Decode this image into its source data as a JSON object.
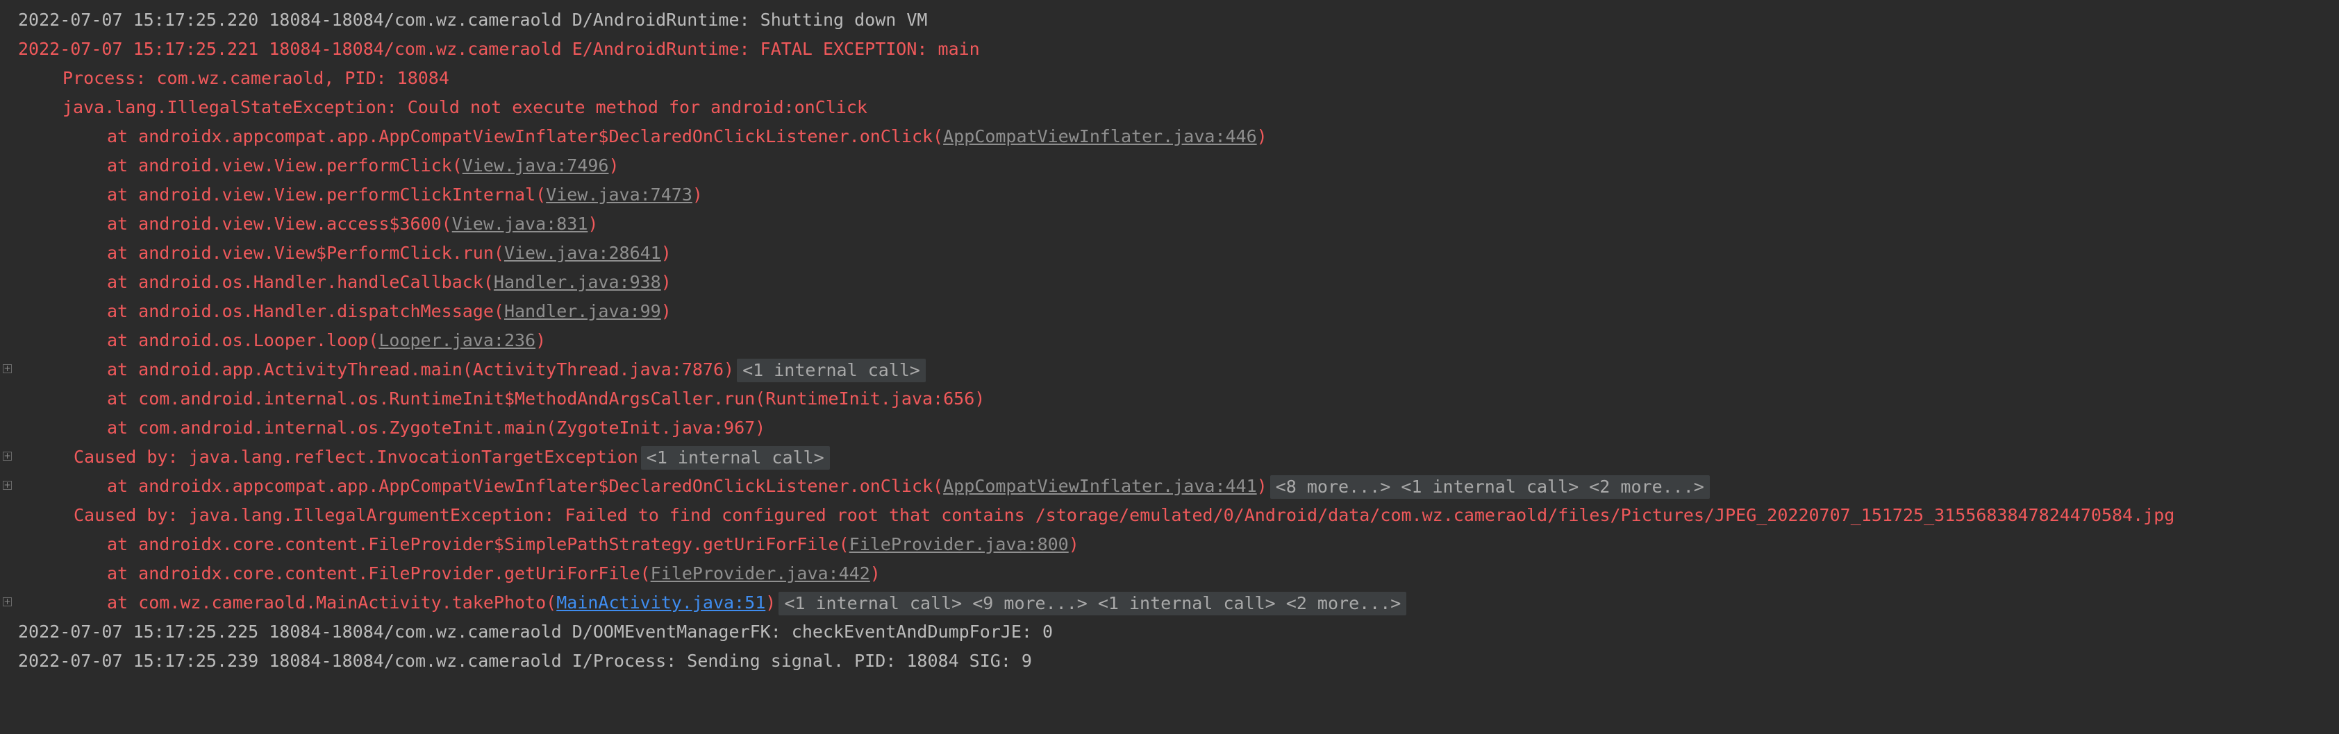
{
  "colors": {
    "background": "#2b2b2b",
    "info_text": "#bbbbbb",
    "error_text": "#f0595b",
    "link_gray": "#8f8f8f",
    "link_blue": "#3f8df0",
    "badge_bg": "#3c3f41"
  },
  "fold_icon": "plus-square-icon",
  "fold_symbol": "+",
  "lines": [
    {
      "t": "2022-07-07 15:17:25.220 18084-18084/com.wz.cameraold D/AndroidRuntime: Shutting down VM"
    },
    {
      "t": "2022-07-07 15:17:25.221 18084-18084/com.wz.cameraold E/AndroidRuntime: FATAL EXCEPTION: main"
    },
    {
      "t": "Process: com.wz.cameraold, PID: 18084"
    },
    {
      "t": "java.lang.IllegalStateException: Could not execute method for android:onClick"
    },
    {
      "pre": "at androidx.appcompat.app.AppCompatViewInflater$DeclaredOnClickListener.onClick(",
      "link": "AppCompatViewInflater.java:446",
      "post": ")"
    },
    {
      "pre": "at android.view.View.performClick(",
      "link": "View.java:7496",
      "post": ")"
    },
    {
      "pre": "at android.view.View.performClickInternal(",
      "link": "View.java:7473",
      "post": ")"
    },
    {
      "pre": "at android.view.View.access$3600(",
      "link": "View.java:831",
      "post": ")"
    },
    {
      "pre": "at android.view.View$PerformClick.run(",
      "link": "View.java:28641",
      "post": ")"
    },
    {
      "pre": "at android.os.Handler.handleCallback(",
      "link": "Handler.java:938",
      "post": ")"
    },
    {
      "pre": "at android.os.Handler.dispatchMessage(",
      "link": "Handler.java:99",
      "post": ")"
    },
    {
      "pre": "at android.os.Looper.loop(",
      "link": "Looper.java:236",
      "post": ")"
    },
    {
      "t": "at android.app.ActivityThread.main(ActivityThread.java:7876)",
      "badge": "<1 internal call>"
    },
    {
      "t": "at com.android.internal.os.RuntimeInit$MethodAndArgsCaller.run(RuntimeInit.java:656)"
    },
    {
      "t": "at com.android.internal.os.ZygoteInit.main(ZygoteInit.java:967)"
    },
    {
      "t": "Caused by: java.lang.reflect.InvocationTargetException",
      "badge": "<1 internal call>"
    },
    {
      "pre": "at androidx.appcompat.app.AppCompatViewInflater$DeclaredOnClickListener.onClick(",
      "link": "AppCompatViewInflater.java:441",
      "post": ")",
      "badge": "<8 more...> <1 internal call> <2 more...>"
    },
    {
      "t": "Caused by: java.lang.IllegalArgumentException: Failed to find configured root that contains /storage/emulated/0/Android/data/com.wz.cameraold/files/Pictures/JPEG_20220707_151725_3155683847824470584.jpg"
    },
    {
      "pre": "at androidx.core.content.FileProvider$SimplePathStrategy.getUriForFile(",
      "link": "FileProvider.java:800",
      "post": ")"
    },
    {
      "pre": "at androidx.core.content.FileProvider.getUriForFile(",
      "link": "FileProvider.java:442",
      "post": ")"
    },
    {
      "pre": "at com.wz.cameraold.MainActivity.takePhoto(",
      "link": "MainActivity.java:51",
      "post": ")",
      "badge": "<1 internal call> <9 more...> <1 internal call> <2 more...>"
    },
    {
      "t": "2022-07-07 15:17:25.225 18084-18084/com.wz.cameraold D/OOMEventManagerFK: checkEventAndDumpForJE: 0"
    },
    {
      "t": "2022-07-07 15:17:25.239 18084-18084/com.wz.cameraold I/Process: Sending signal. PID: 18084 SIG: 9"
    }
  ]
}
